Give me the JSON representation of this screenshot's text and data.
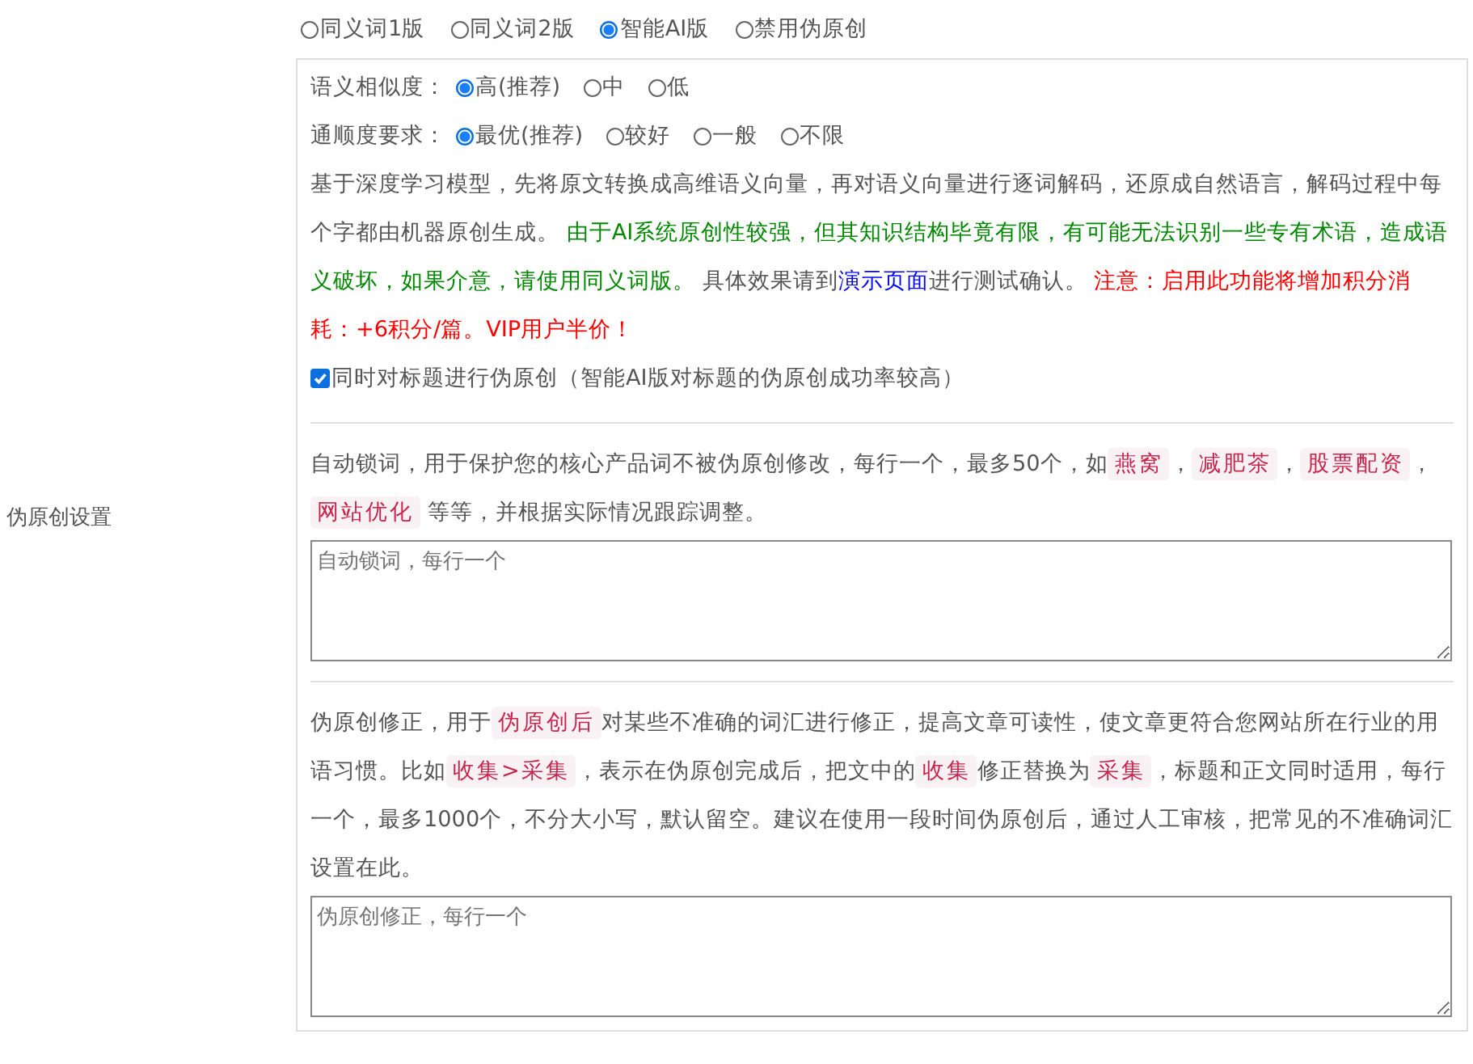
{
  "sidebar_label": "伪原创设置",
  "modes": [
    {
      "label": "同义词1版",
      "selected": false
    },
    {
      "label": "同义词2版",
      "selected": false
    },
    {
      "label": "智能AI版",
      "selected": true
    },
    {
      "label": "禁用伪原创",
      "selected": false
    }
  ],
  "similarity": {
    "label": "语义相似度：",
    "options": [
      {
        "label": "高(推荐)",
        "selected": true
      },
      {
        "label": "中",
        "selected": false
      },
      {
        "label": "低",
        "selected": false
      }
    ]
  },
  "fluency": {
    "label": "通顺度要求：",
    "options": [
      {
        "label": "最优(推荐)",
        "selected": true
      },
      {
        "label": "较好",
        "selected": false
      },
      {
        "label": "一般",
        "selected": false
      },
      {
        "label": "不限",
        "selected": false
      }
    ]
  },
  "ai_description": [
    {
      "kind": "text",
      "text": "基于深度学习模型，先将原文转换成高维语义向量，再对语义向量进行逐词解码，还原成自然语言，解码过程中每个字都由机器原创生成。 "
    },
    {
      "kind": "note",
      "text": "由于AI系统原创性较强，但其知识结构毕竟有限，有可能无法识别一些专有术语，造成语义破坏，如果介意，请使用同义词版。"
    },
    {
      "kind": "text",
      "text": " 具体效果请到"
    },
    {
      "kind": "link",
      "text": "演示页面"
    },
    {
      "kind": "text",
      "text": "进行测试确认。 "
    },
    {
      "kind": "warn",
      "text": "注意：启用此功能将增加积分消耗：+6积分/篇。VIP用户半价！"
    }
  ],
  "title_option": {
    "label": "同时对标题进行伪原创（智能AI版对标题的伪原创成功率较高）",
    "checked": true
  },
  "lock_words": {
    "description": [
      {
        "kind": "text",
        "text": "自动锁词，用于保护您的核心产品词不被伪原创修改，每行一个，最多50个，如"
      },
      {
        "kind": "code",
        "text": "燕窝"
      },
      {
        "kind": "text",
        "text": "，"
      },
      {
        "kind": "code",
        "text": "减肥茶"
      },
      {
        "kind": "text",
        "text": "，"
      },
      {
        "kind": "code",
        "text": "股票配资"
      },
      {
        "kind": "text",
        "text": "，"
      },
      {
        "kind": "code",
        "text": "网站优化"
      },
      {
        "kind": "text",
        "text": " 等等，并根据实际情况跟踪调整。"
      }
    ]
  },
  "corrections": {
    "description": [
      {
        "kind": "text",
        "text": "伪原创修正，用于"
      },
      {
        "kind": "code",
        "text": "伪原创后"
      },
      {
        "kind": "text",
        "text": "对某些不准确的词汇进行修正，提高文章可读性，使文章更符合您网站所在行业的用语习惯。比如"
      },
      {
        "kind": "code",
        "text": "收集>采集"
      },
      {
        "kind": "text",
        "text": "，表示在伪原创完成后，把文中的"
      },
      {
        "kind": "code",
        "text": "收集"
      },
      {
        "kind": "text",
        "text": "修正替换为"
      },
      {
        "kind": "code",
        "text": "采集"
      },
      {
        "kind": "text",
        "text": "，标题和正文同时适用，每行一个，最多1000个，不分大小写，默认留空。建议在使用一段时间伪原创后，通过人工审核，把常见的不准确词汇设置在此。"
      }
    ],
    "placeholder": "伪原创修正，每行一个"
  },
  "lock_words_placeholder": "自动锁词，每行一个"
}
